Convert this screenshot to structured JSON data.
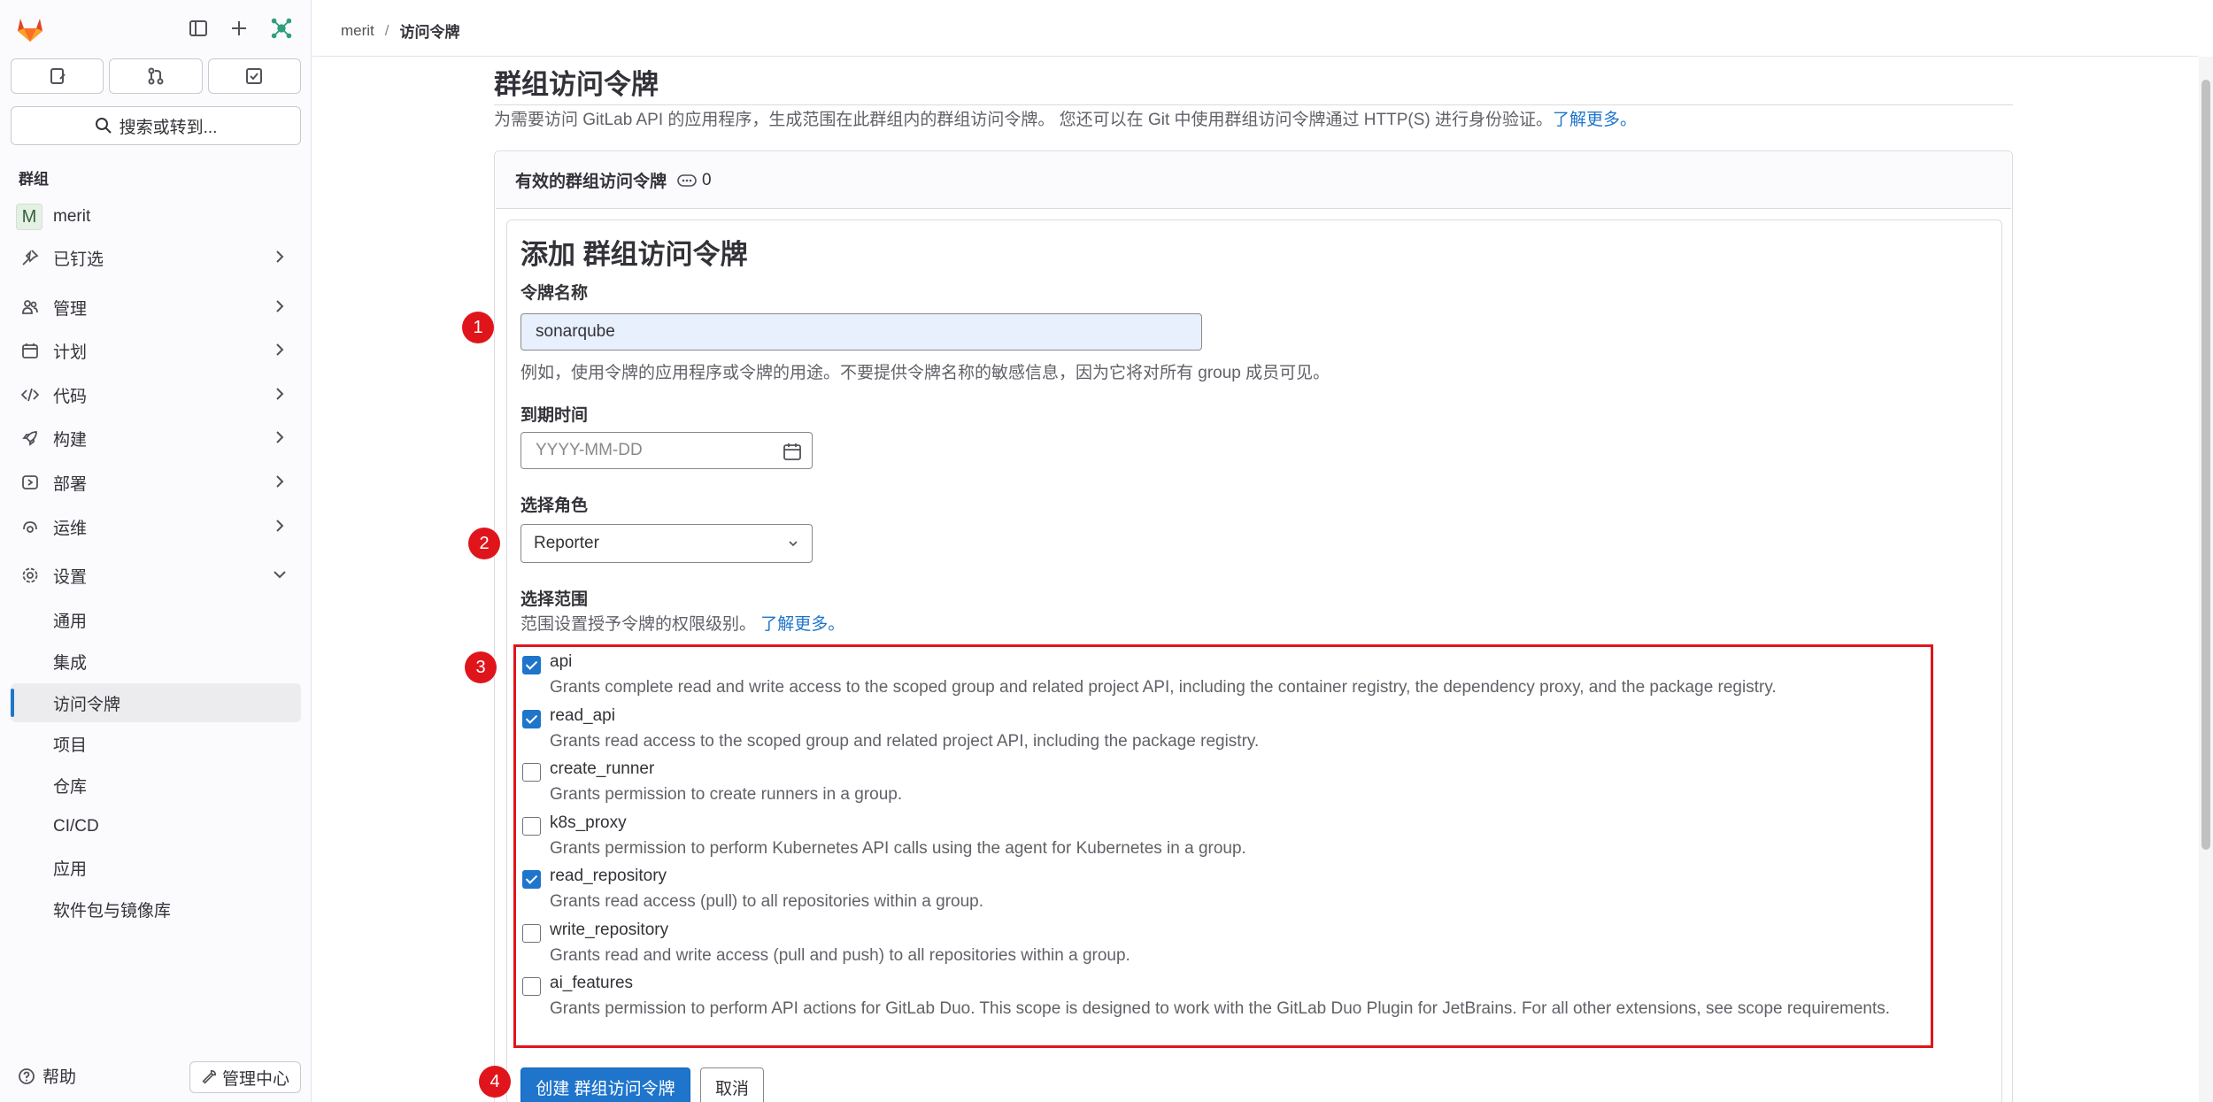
{
  "colors": {
    "accent": "#1f75cb",
    "marker": "#e0151b",
    "sidebar_bg": "#fbfafd"
  },
  "sidebar": {
    "search_label": "搜索或转到...",
    "section_label": "群组",
    "group_avatar": "M",
    "group_name": "merit",
    "items": [
      {
        "label": "已钉选",
        "icon": "pin-icon"
      },
      {
        "label": "管理",
        "icon": "users-icon"
      },
      {
        "label": "计划",
        "icon": "calendar-icon"
      },
      {
        "label": "代码",
        "icon": "code-icon"
      },
      {
        "label": "构建",
        "icon": "rocket-icon"
      },
      {
        "label": "部署",
        "icon": "deploy-icon"
      },
      {
        "label": "运维",
        "icon": "monitor-icon"
      },
      {
        "label": "设置",
        "icon": "gear-icon"
      }
    ],
    "settings_sub": [
      "通用",
      "集成",
      "访问令牌",
      "项目",
      "仓库",
      "CI/CD",
      "应用",
      "软件包与镜像库"
    ],
    "help_label": "帮助",
    "admin_label": "管理中心"
  },
  "breadcrumb": {
    "group": "merit",
    "sep": "/",
    "current": "访问令牌"
  },
  "page": {
    "title": "群组访问令牌",
    "desc_text": "为需要访问 GitLab API 的应用程序，生成范围在此群组内的群组访问令牌。 您还可以在 Git 中使用群组访问令牌通过 HTTP(S) 进行身份验证。",
    "desc_link": "了解更多。"
  },
  "card": {
    "header_label": "有效的群组访问令牌",
    "count": "0"
  },
  "form": {
    "title": "添加 群组访问令牌",
    "name_label": "令牌名称",
    "name_value": "sonarqube",
    "name_help": "例如，使用令牌的应用程序或令牌的用途。不要提供令牌名称的敏感信息，因为它将对所有 group 成员可见。",
    "expiry_label": "到期时间",
    "expiry_placeholder": "YYYY-MM-DD",
    "role_label": "选择角色",
    "role_value": "Reporter",
    "scope_label": "选择范围",
    "scope_help": "范围设置授予令牌的权限级别。",
    "scope_help_link": "了解更多。",
    "scopes": [
      {
        "name": "api",
        "checked": true,
        "desc": "Grants complete read and write access to the scoped group and related project API, including the container registry, the dependency proxy, and the package registry."
      },
      {
        "name": "read_api",
        "checked": true,
        "desc": "Grants read access to the scoped group and related project API, including the package registry."
      },
      {
        "name": "create_runner",
        "checked": false,
        "desc": "Grants permission to create runners in a group."
      },
      {
        "name": "k8s_proxy",
        "checked": false,
        "desc": "Grants permission to perform Kubernetes API calls using the agent for Kubernetes in a group."
      },
      {
        "name": "read_repository",
        "checked": true,
        "desc": "Grants read access (pull) to all repositories within a group."
      },
      {
        "name": "write_repository",
        "checked": false,
        "desc": "Grants read and write access (pull and push) to all repositories within a group."
      },
      {
        "name": "ai_features",
        "checked": false,
        "desc": "Grants permission to perform API actions for GitLab Duo. This scope is designed to work with the GitLab Duo Plugin for JetBrains. For all other extensions, see scope requirements."
      }
    ],
    "submit_label": "创建 群组访问令牌",
    "cancel_label": "取消"
  },
  "markers": [
    "1",
    "2",
    "3",
    "4"
  ]
}
